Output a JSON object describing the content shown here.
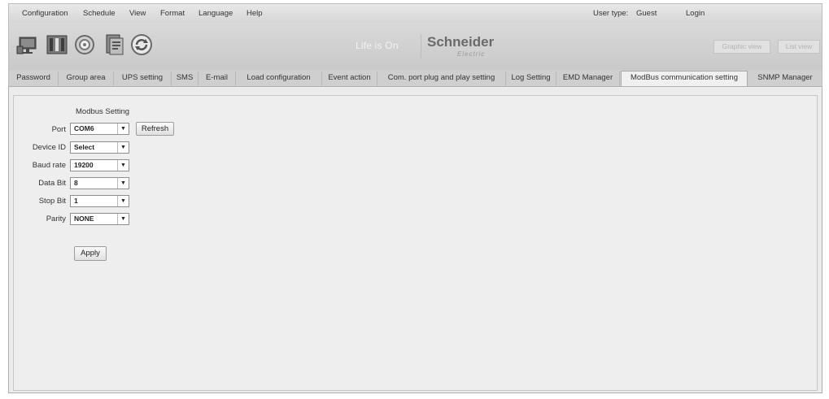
{
  "menubar": {
    "items": [
      "Configuration",
      "Schedule",
      "View",
      "Format",
      "Language",
      "Help"
    ],
    "user_type_label": "User type:",
    "user_type_value": "Guest",
    "login": "Login"
  },
  "toolbar": {
    "icons": [
      "monitor-icon",
      "tools-icon",
      "gear-icon",
      "document-icon",
      "refresh-icon"
    ],
    "tagline": "Life is On",
    "brand": "Schneider",
    "brand_sub": "Electric",
    "graphic_view": "Graphic view",
    "list_view": "List view"
  },
  "tabs": [
    "Password",
    "Group area",
    "UPS setting",
    "SMS",
    "E-mail",
    "Load configuration",
    "Event action",
    "Com. port plug and play setting",
    "Log Setting",
    "EMD Manager",
    "ModBus communication setting",
    "SNMP Manager"
  ],
  "active_tab_index": 10,
  "modbus": {
    "title": "Modbus Setting",
    "port_label": "Port",
    "port_value": "COM6",
    "refresh": "Refresh",
    "device_id_label": "Device ID",
    "device_id_value": "Select",
    "baud_rate_label": "Baud rate",
    "baud_rate_value": "19200",
    "data_bit_label": "Data Bit",
    "data_bit_value": "8",
    "stop_bit_label": "Stop Bit",
    "stop_bit_value": "1",
    "parity_label": "Parity",
    "parity_value": "NONE",
    "apply": "Apply"
  }
}
